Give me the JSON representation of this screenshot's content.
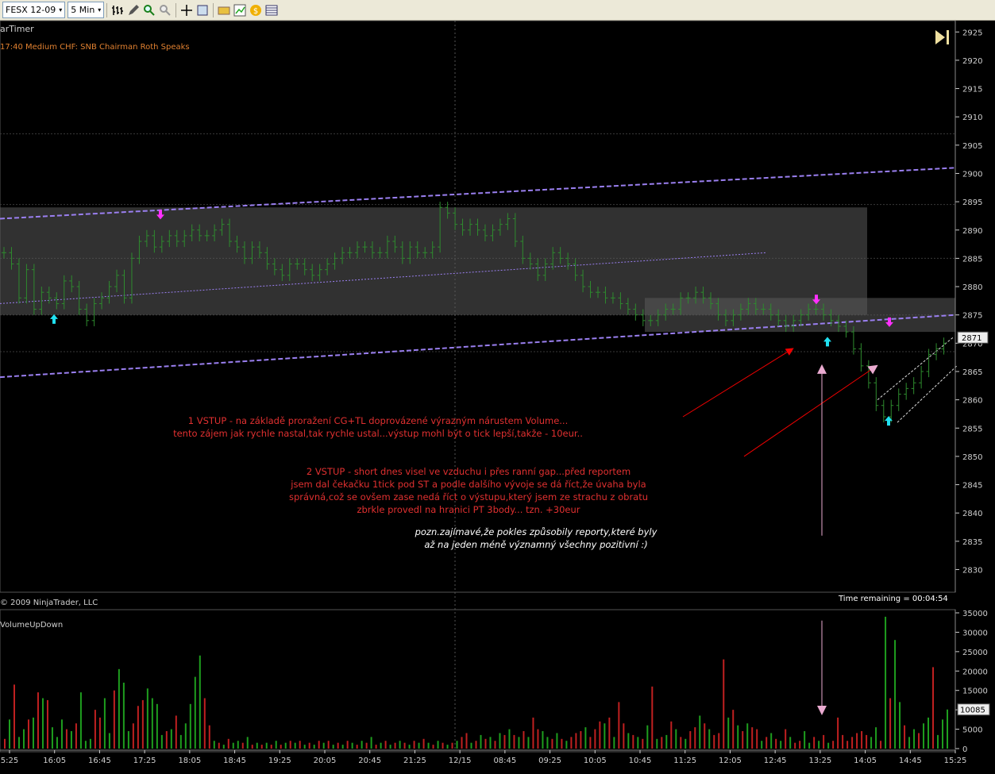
{
  "toolbar": {
    "instrument": "FESX 12-09",
    "interval": "5 Min",
    "chevron": "▾"
  },
  "price_panel": {
    "indicator_label": "arTimer",
    "news_line": "17:40 Medium   CHF: SNB Chairman Roth Speaks",
    "copyright": "© 2009 NinjaTrader, LLC",
    "time_remaining": "Time remaining = 00:04:54",
    "price_ticks": [
      "2925",
      "2920",
      "2915",
      "2910",
      "2905",
      "2900",
      "2895",
      "2890",
      "2885",
      "2880",
      "2875",
      "2870",
      "2865",
      "2860",
      "2855",
      "2850",
      "2845",
      "2840",
      "2835",
      "2830"
    ],
    "last_price": "2871"
  },
  "annotations": {
    "note1_line1": "1 VSTUP - na základě proražení CG+TL doprovázené výrazným nárustem Volume...",
    "note1_line2": "tento zájem jak rychle nastal,tak rychle ustal...výstup mohl být o tick lepší,takže - 10eur..",
    "note2_line1": "2 VSTUP - short dnes visel ve vzduchu i přes ranní gap...před reportem",
    "note2_line2": "jsem dal čekačku 1tick pod ST a podle dalšího vývoje se dá říct,že úvaha byla",
    "note2_line3": "správná,což se ovšem zase nedá říct o výstupu,který jsem ze strachu z obratu",
    "note2_line4": "zbrkle provedl na hranici PT 3body... tzn. +30eur",
    "note3_line1": "pozn.zajímavé,že pokles způsobily reporty,které byly",
    "note3_line2": "až na jeden méně významný všechny pozitivní :)"
  },
  "volume_panel": {
    "label": "VolumeUpDown",
    "ticks": [
      "35000",
      "30000",
      "25000",
      "20000",
      "15000",
      "10000",
      "5000",
      "0"
    ],
    "last_volume": "10085"
  },
  "time_axis": [
    "5:25",
    "16:05",
    "16:45",
    "17:25",
    "18:05",
    "18:45",
    "19:25",
    "20:05",
    "20:45",
    "21:25",
    "12/15",
    "08:45",
    "09:25",
    "10:05",
    "10:45",
    "11:25",
    "12:05",
    "12:45",
    "13:25",
    "14:05",
    "14:45",
    "15:25"
  ],
  "chart_data": {
    "type": "bar",
    "price_range": [
      2826,
      2927
    ],
    "volume_range": [
      0,
      35000
    ],
    "prices": [
      2886,
      2884,
      2878,
      2883,
      2876,
      2879,
      2878,
      2877,
      2881,
      2880,
      2876,
      2874,
      2877,
      2878,
      2880,
      2882,
      2878,
      2885,
      2888,
      2889,
      2887,
      2888,
      2889,
      2888,
      2889,
      2890,
      2889,
      2889,
      2890,
      2891,
      2888,
      2887,
      2885,
      2887,
      2886,
      2884,
      2883,
      2882,
      2884,
      2884,
      2883,
      2882,
      2883,
      2884,
      2885,
      2886,
      2886,
      2887,
      2887,
      2886,
      2886,
      2888,
      2887,
      2885,
      2887,
      2886,
      2886,
      2887,
      2894,
      2893,
      2891,
      2890,
      2891,
      2890,
      2889,
      2890,
      2891,
      2892,
      2888,
      2885,
      2884,
      2882,
      2884,
      2886,
      2885,
      2884,
      2882,
      2880,
      2879,
      2879,
      2878,
      2878,
      2877,
      2876,
      2875,
      2874,
      2874,
      2875,
      2876,
      2876,
      2878,
      2878,
      2879,
      2878,
      2877,
      2875,
      2874,
      2875,
      2876,
      2877,
      2876,
      2876,
      2875,
      2874,
      2873,
      2874,
      2875,
      2876,
      2876,
      2875,
      2874,
      2873,
      2872,
      2869,
      2866,
      2863,
      2859,
      2857,
      2859,
      2861,
      2862,
      2863,
      2865,
      2868,
      2869,
      2870
    ],
    "volumes": [
      2500,
      7500,
      16500,
      3000,
      5000,
      7500,
      8000,
      14500,
      13000,
      12500,
      5500,
      3000,
      7500,
      5000,
      4500,
      6500,
      14500,
      2000,
      2500,
      10000,
      8000,
      13000,
      4000,
      15000,
      20500,
      17000,
      4500,
      6500,
      11000,
      12500,
      15500,
      13000,
      11500,
      3500,
      4500,
      5000,
      8500,
      3500,
      6500,
      11500,
      18500,
      24000,
      13000,
      6000,
      2000,
      1500,
      1000,
      2500,
      1500,
      2000,
      1500,
      3000,
      1000,
      1500,
      1000,
      1500,
      1000,
      2000,
      1000,
      1500,
      2000,
      1500,
      2000,
      1000,
      1500,
      1000,
      2000,
      1500,
      2000,
      1000,
      1500,
      1000,
      2000,
      1500,
      1000,
      2000,
      1500,
      3000,
      1000,
      1500,
      2000,
      1000,
      1500,
      2000,
      1500,
      1000,
      2000,
      1500,
      2500,
      1500,
      1000,
      2000,
      1500,
      1000,
      1500,
      2000,
      3000,
      4000,
      1500,
      2000,
      3500,
      2500,
      3000,
      2000,
      4000,
      3500,
      5000,
      3500,
      3000,
      4500,
      3000,
      8000,
      5000,
      4500,
      3000,
      2500,
      4000,
      2500,
      2000,
      3000,
      4000,
      4500,
      5500,
      3000,
      5000,
      7000,
      6500,
      8000,
      3000,
      12000,
      6500,
      4000,
      3500,
      3000,
      2500,
      6000,
      16000,
      2500,
      3000,
      3500,
      7000,
      5000,
      3000,
      2500,
      4500,
      5500,
      8500,
      6500,
      5000,
      3500,
      4000,
      23000,
      8000,
      10000,
      6000,
      4500,
      6500,
      5500,
      5000,
      2000,
      3000,
      4000,
      2500,
      2000,
      5000,
      3000,
      1500,
      2000,
      4500,
      1500,
      3000,
      2000,
      3500,
      1500,
      2000,
      8000,
      3500,
      2000,
      3000,
      4000,
      4500,
      3500,
      3000,
      5500,
      2000,
      34000,
      13000,
      28000,
      12000,
      6000,
      3000,
      5000,
      4000,
      6500,
      8000,
      21000,
      3500,
      7500,
      10085
    ],
    "up": [
      false,
      true,
      false,
      true,
      true,
      false,
      true,
      false,
      true,
      false,
      true,
      true,
      true,
      false,
      true,
      false,
      true,
      true,
      true,
      false,
      false,
      true,
      true,
      false,
      true,
      true,
      true,
      false,
      false,
      false,
      true,
      true,
      true,
      true,
      false,
      true,
      false,
      true,
      true,
      true,
      true,
      true,
      false,
      false,
      true,
      false,
      true,
      false,
      true,
      true,
      false,
      true,
      false,
      true,
      false,
      true,
      false,
      true,
      false,
      true,
      false,
      true,
      false,
      true,
      false,
      true,
      false,
      true,
      false,
      true,
      false,
      true,
      false,
      true,
      false,
      true,
      false,
      true,
      false,
      true,
      false,
      true,
      false,
      true,
      false,
      true,
      false,
      true,
      false,
      true,
      false,
      true,
      false,
      true,
      false,
      true,
      false,
      false,
      true,
      false,
      true,
      false,
      true,
      false,
      true,
      false,
      true,
      false,
      true,
      false,
      true,
      false,
      false,
      true,
      true,
      false,
      true,
      false,
      true,
      false,
      false,
      false,
      true,
      false,
      false,
      false,
      true,
      false,
      true,
      false,
      false,
      true,
      false,
      true,
      false,
      true,
      false,
      true,
      false,
      true,
      false,
      true,
      false,
      true,
      false,
      false,
      true,
      false,
      true,
      false,
      false,
      false,
      true,
      false,
      true,
      false,
      true,
      false,
      false,
      true,
      false,
      true,
      false,
      true,
      false,
      true,
      false,
      false,
      true,
      true,
      false,
      true,
      false,
      true,
      false,
      false,
      false,
      false,
      false,
      false,
      false,
      false,
      true,
      true,
      false,
      true,
      false,
      true,
      true,
      false,
      true,
      true,
      false,
      true,
      true,
      false,
      true,
      true,
      true
    ]
  },
  "colors": {
    "bg": "#000000",
    "grid": "#3a3a3a",
    "bar": "#2e8b2e",
    "up_vol": "#1e9e1e",
    "down_vol": "#c02020",
    "channel": "#9a7ff0",
    "zone": "rgba(90,90,90,0.55)",
    "note": "#e03030",
    "note3": "#ffffff",
    "axis": "#cfcfcf",
    "tick_label": "#cfcfcf"
  }
}
